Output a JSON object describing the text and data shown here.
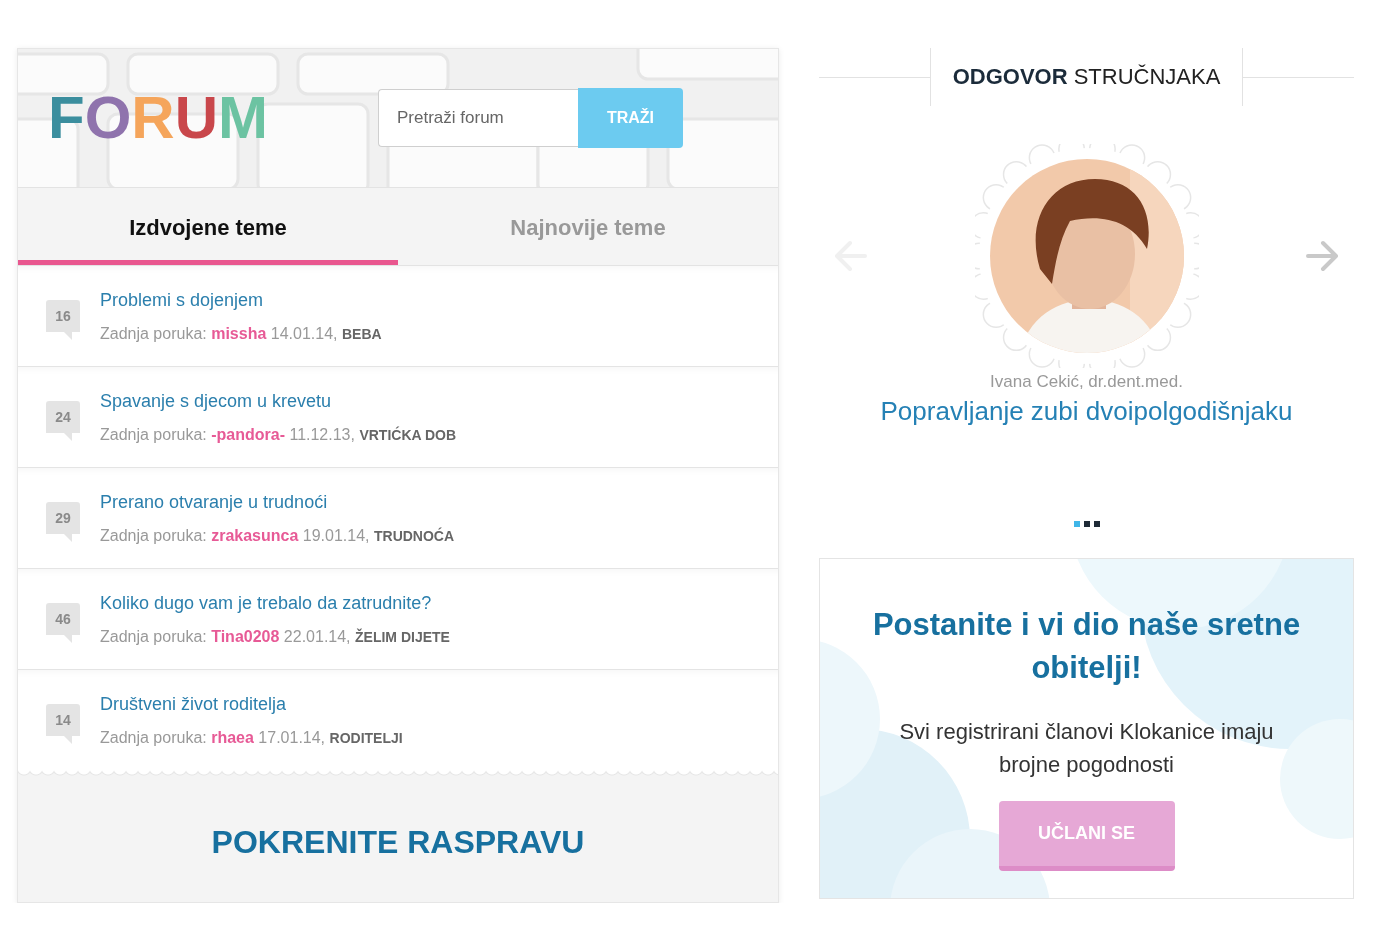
{
  "forum": {
    "logo": "FORUM",
    "search": {
      "placeholder": "Pretraži forum",
      "button": "TRAŽI"
    },
    "tabs": [
      {
        "label": "Izdvojene teme",
        "selected": true
      },
      {
        "label": "Najnovije teme",
        "selected": false
      }
    ],
    "topics": [
      {
        "count": "16",
        "title": "Problemi s dojenjem",
        "meta": "Zadnja poruka: **missha** 14.01.14, **BEBA**"
      },
      {
        "count": "24",
        "title": "Spavanje s djecom u krevetu",
        "meta": "Zadnja poruka: **-pandora-** 11.12.13, **VRTIĆKA DOB**"
      },
      {
        "count": "29",
        "title": "Prerano otvaranje u trudnoći",
        "meta": "Zadnja poruka: **zrakasunca** 19.01.14, **TRUDNOĆA**"
      },
      {
        "count": "46",
        "title": "Koliko dugo vam je trebalo da zatrudnite?",
        "meta": "Zadnja poruka: **Tina0208** 22.01.14, **ŽELIM DIJETE**"
      },
      {
        "count": "14",
        "title": "Društveni život roditelja",
        "meta": "Zadnja poruka: **rhaea** 17.01.14, **RODITELJI**"
      }
    ],
    "start_button": "POKRENITE RASPRAVU"
  },
  "expert": {
    "heading": "**ODGOVOR** STRUČNJAKA",
    "prev_disabled": true,
    "name": "Ivana Cekić, dr.dent.med.",
    "title": "Popravljanje zubi dvoipolgodišnjaku",
    "dots": [
      {
        "selected": true
      },
      {
        "selected": false
      },
      {
        "selected": false
      }
    ]
  },
  "promo": {
    "title": "Postanite i vi dio naše sretne obitelji!",
    "text": "Svi registrirani članovi Klokanice imaju brojne pogodnosti",
    "button": "UČLANI SE"
  }
}
